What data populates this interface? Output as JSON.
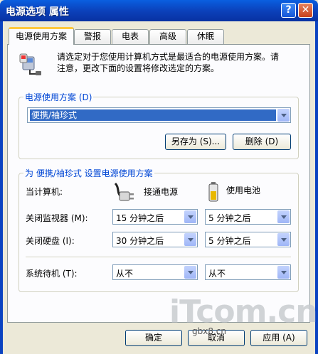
{
  "window": {
    "title": "电源选项 属性",
    "help_label": "?",
    "close_label": "✕"
  },
  "tabs": [
    {
      "label": "电源使用方案",
      "active": true
    },
    {
      "label": "警报",
      "active": false
    },
    {
      "label": "电表",
      "active": false
    },
    {
      "label": "高级",
      "active": false
    },
    {
      "label": "休眠",
      "active": false
    }
  ],
  "intro": {
    "icon": "power-options-icon",
    "line1": "请选定对于您使用计算机方式是最适合的电源使用方案。请",
    "line2": "注意，更改下面的设置将修改选定的方案。"
  },
  "scheme_group": {
    "label": "电源使用方案 (D)",
    "selected": "便携/袖珍式",
    "save_as_label": "另存为 (S)...",
    "delete_label": "删除 (D)"
  },
  "settings_group": {
    "label": "为 便携/袖珍式 设置电源使用方案",
    "computer_label": "当计算机:",
    "plugged_label": "接通电源",
    "plugged_icon": "power-plug-icon",
    "battery_label": "使用电池",
    "battery_icon": "battery-icon",
    "rows": [
      {
        "label": "关闭监视器 (M):",
        "plugged": "15 分钟之后",
        "battery": "5 分钟之后"
      },
      {
        "label": "关闭硬盘 (I):",
        "plugged": "30 分钟之后",
        "battery": "5 分钟之后"
      },
      {
        "label": "系统待机 (T):",
        "plugged": "从不",
        "battery": "从不"
      }
    ]
  },
  "footer": {
    "ok_label": "确定",
    "cancel_label": "取消",
    "apply_label": "应用 (A)"
  },
  "watermark": {
    "text": "iTcom.cn",
    "subtext": "gbx8.cn"
  },
  "colors": {
    "titlebar": "#0b3fb8",
    "group_label": "#0046d5",
    "selection": "#316ac5",
    "tab_highlight": "#ffc83c"
  }
}
